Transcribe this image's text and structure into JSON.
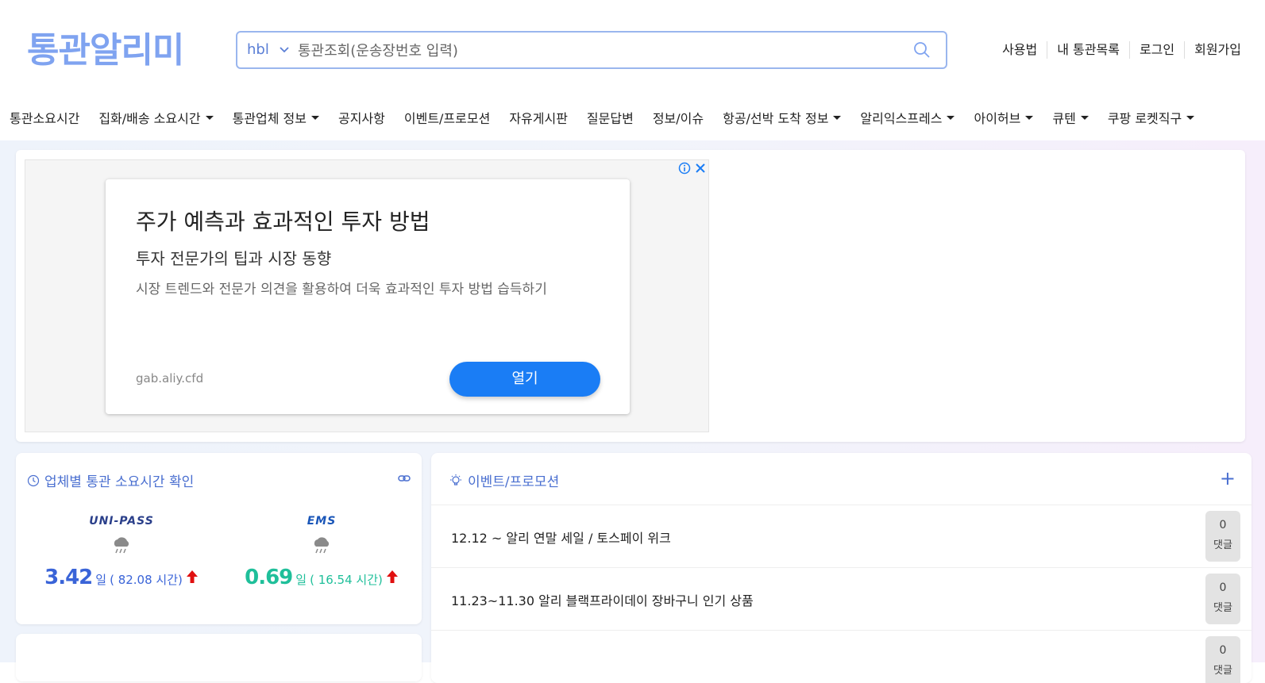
{
  "header": {
    "logo": "통관알리미",
    "search": {
      "type_value": "hbl",
      "placeholder": "통관조회(운송장번호 입력)"
    },
    "top_links": [
      "사용법",
      "내 통관목록",
      "로그인",
      "회원가입"
    ]
  },
  "nav": [
    {
      "label": "통관소요시간",
      "dropdown": false
    },
    {
      "label": "집화/배송 소요시간",
      "dropdown": true
    },
    {
      "label": "통관업체 정보",
      "dropdown": true
    },
    {
      "label": "공지사항",
      "dropdown": false
    },
    {
      "label": "이벤트/프로모션",
      "dropdown": false
    },
    {
      "label": "자유게시판",
      "dropdown": false
    },
    {
      "label": "질문답변",
      "dropdown": false
    },
    {
      "label": "정보/이슈",
      "dropdown": false
    },
    {
      "label": "항공/선박 도착 정보",
      "dropdown": true
    },
    {
      "label": "알리익스프레스",
      "dropdown": true
    },
    {
      "label": "아이허브",
      "dropdown": true
    },
    {
      "label": "큐텐",
      "dropdown": true
    },
    {
      "label": "쿠팡 로켓직구",
      "dropdown": true
    }
  ],
  "ad": {
    "headline": "주가 예측과 효과적인 투자 방법",
    "subheadline": "투자 전문가의 팁과 시장 동향",
    "description": "시장 트렌드와 전문가 의견을 활용하여 더욱 효과적인 투자 방법 습득하기",
    "url": "gab.aliy.cfd",
    "button": "열기"
  },
  "customs_card": {
    "title": "업체별 통관 소요시간 확인",
    "items": [
      {
        "logo": "UNI-PASS",
        "days": "3.42",
        "unit": "일",
        "hours": "( 82.08 시간)",
        "color": "#3a64d8"
      },
      {
        "logo": "EMS",
        "days": "0.69",
        "unit": "일",
        "hours": "( 16.54 시간)",
        "color": "#1fbf9a"
      }
    ]
  },
  "events_card": {
    "title": "이벤트/프로모션",
    "add_label": "+",
    "rows": [
      {
        "text": "12.12 ~ 알리 연말 세일 / 토스페이 위크",
        "count": "0",
        "count_label": "댓글"
      },
      {
        "text": "11.23~11.30 알리 블랙프라이데이 장바구니 인기 상품",
        "count": "0",
        "count_label": "댓글"
      },
      {
        "text": "",
        "count": "0",
        "count_label": "댓글"
      }
    ]
  },
  "colors": {
    "accent": "#4a6fd0",
    "logo": "#7fa3f0",
    "ad_button": "#1a7df5",
    "up_arrow": "#e01010"
  }
}
